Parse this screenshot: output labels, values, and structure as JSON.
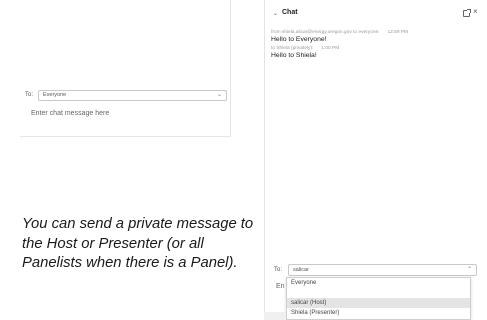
{
  "left_panel": {
    "to_label": "To:",
    "recipient": "Everyone",
    "input_placeholder": "Enter chat message here"
  },
  "caption": "You can send a private message to the Host or Presenter (or all Panelists when there is a Panel).",
  "chat": {
    "title": "Chat",
    "messages": [
      {
        "meta": "from shiela.alicar@energy.oregon.gov to everyone:",
        "time": "12:59 PM",
        "text": "Hello to Everyone!"
      },
      {
        "meta": "to Shiela (privately):",
        "time": "1:00 PM",
        "text": "Hello to Shiela!"
      }
    ],
    "to_label": "To:",
    "recipient_input": "salicar",
    "input_hint": "En",
    "dropdown_options": [
      "Everyone",
      "salicar (Host)",
      "Shiela (Presenter)"
    ],
    "selected_option": "salicar (Host)"
  }
}
